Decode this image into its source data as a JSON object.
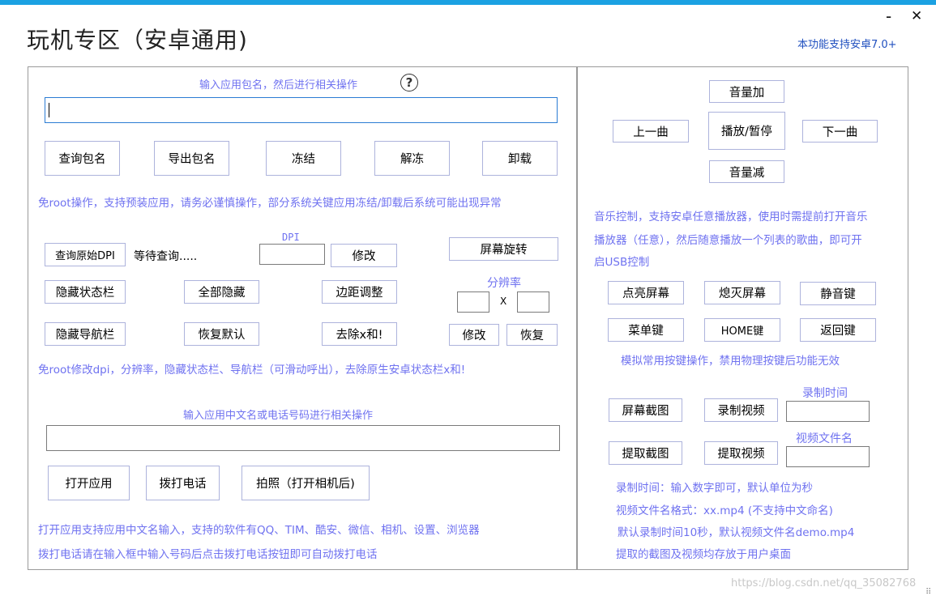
{
  "window": {
    "title": "玩机专区（安卓通用)",
    "minimize_glyph": "-",
    "close_glyph": "✕",
    "support_text": "本功能支持安卓7.0+"
  },
  "left": {
    "package_prompt": "输入应用包名，然后进行相关操作",
    "help_glyph": "?",
    "package_input_value": "",
    "pkg_buttons": [
      "查询包名",
      "导出包名",
      "冻结",
      "解冻",
      "卸载"
    ],
    "pkg_note": "免root操作，支持预装应用，请务必谨慎操作，部分系统关键应用冻结/卸载后系统可能出现异常",
    "dpi": {
      "query_button": "查询原始DPI",
      "status": "等待查询.....",
      "label": "DPI",
      "input_value": "",
      "modify_button": "修改"
    },
    "rotate_button": "屏幕旋转",
    "resolution": {
      "label": "分辨率",
      "separator": "X",
      "width_value": "",
      "height_value": "",
      "modify_button": "修改",
      "restore_button": "恢复"
    },
    "bar_buttons": {
      "hide_status": "隐藏状态栏",
      "hide_all": "全部隐藏",
      "margin": "边距调整",
      "hide_nav": "隐藏导航栏",
      "restore_default": "恢复默认",
      "remove_x": "去除x和!"
    },
    "dpi_note": "免root修改dpi，分辨率，隐藏状态栏、导航栏（可滑动呼出），去除原生安卓状态栏x和!",
    "app_prompt": "输入应用中文名或电话号码进行相关操作",
    "app_input_value": "",
    "app_buttons": [
      "打开应用",
      "拨打电话",
      "拍照（打开相机后)"
    ],
    "app_notes": [
      "打开应用支持应用中文名输入，支持的软件有QQ、TIM、酷安、微信、相机、设置、浏览器",
      "拨打电话请在输入框中输入号码后点击拨打电话按钮即可自动拨打电话"
    ]
  },
  "right": {
    "music": {
      "vol_up": "音量加",
      "prev": "上一曲",
      "play_pause": "播放/暂停",
      "next": "下一曲",
      "vol_down": "音量减"
    },
    "music_note": [
      "音乐控制，支持安卓任意播放器，使用时需提前打开音乐",
      "播放器（任意），然后随意播放一个列表的歌曲，即可开",
      "启USB控制"
    ],
    "keys": {
      "wake": "点亮屏幕",
      "sleep": "熄灭屏幕",
      "mute": "静音键",
      "menu": "菜单键",
      "home": "HOME键",
      "back": "返回键"
    },
    "keys_note": "模拟常用按键操作，禁用物理按键后功能无效",
    "record": {
      "screenshot": "屏幕截图",
      "record_video": "录制视频",
      "time_label": "录制时间",
      "time_value": "",
      "pull_screenshot": "提取截图",
      "pull_video": "提取视频",
      "filename_label": "视频文件名",
      "filename_value": ""
    },
    "record_notes": [
      "录制时间：输入数字即可，默认单位为秒",
      "视频文件名格式：xx.mp4 (不支持中文命名)",
      "默认录制时间10秒，默认视频文件名demo.mp4",
      "提取的截图及视频均存放于用户桌面"
    ]
  },
  "watermark": "https://blog.csdn.net/qq_35082768",
  "colors": {
    "topbar": "#1ba1e2",
    "accent_text": "#6f72f0",
    "support_text": "#1f4fbf",
    "button_border": "#adb3dc",
    "input_focus": "#2b7cd3"
  }
}
